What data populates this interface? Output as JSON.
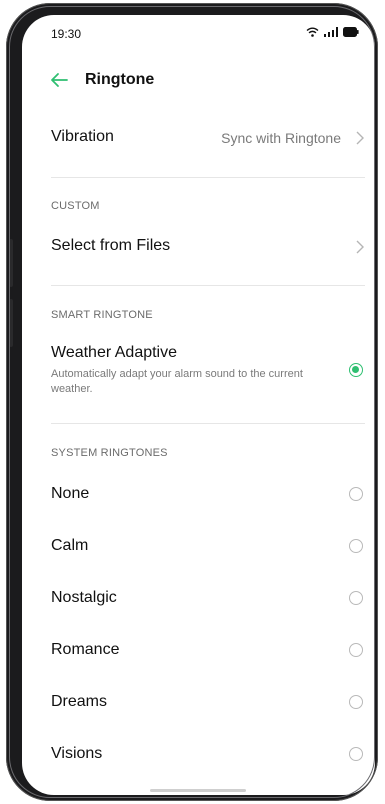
{
  "status": {
    "time": "19:30"
  },
  "header": {
    "title": "Ringtone"
  },
  "vibration": {
    "label": "Vibration",
    "value": "Sync with Ringtone"
  },
  "custom": {
    "section": "CUSTOM",
    "select_label": "Select from Files"
  },
  "smart": {
    "section": "SMART RINGTONE",
    "label": "Weather Adaptive",
    "description": "Automatically adapt your alarm sound to the current weather.",
    "selected": true
  },
  "system": {
    "section": "SYSTEM RINGTONES",
    "items": [
      {
        "label": "None"
      },
      {
        "label": "Calm"
      },
      {
        "label": "Nostalgic"
      },
      {
        "label": "Romance"
      },
      {
        "label": "Dreams"
      },
      {
        "label": "Visions"
      }
    ]
  },
  "colors": {
    "accent": "#2fbf71",
    "back_arrow": "#2fbf71"
  },
  "icons": [
    "wifi-icon",
    "signal-icon",
    "battery-icon",
    "back-arrow-icon",
    "chevron-right-icon"
  ]
}
